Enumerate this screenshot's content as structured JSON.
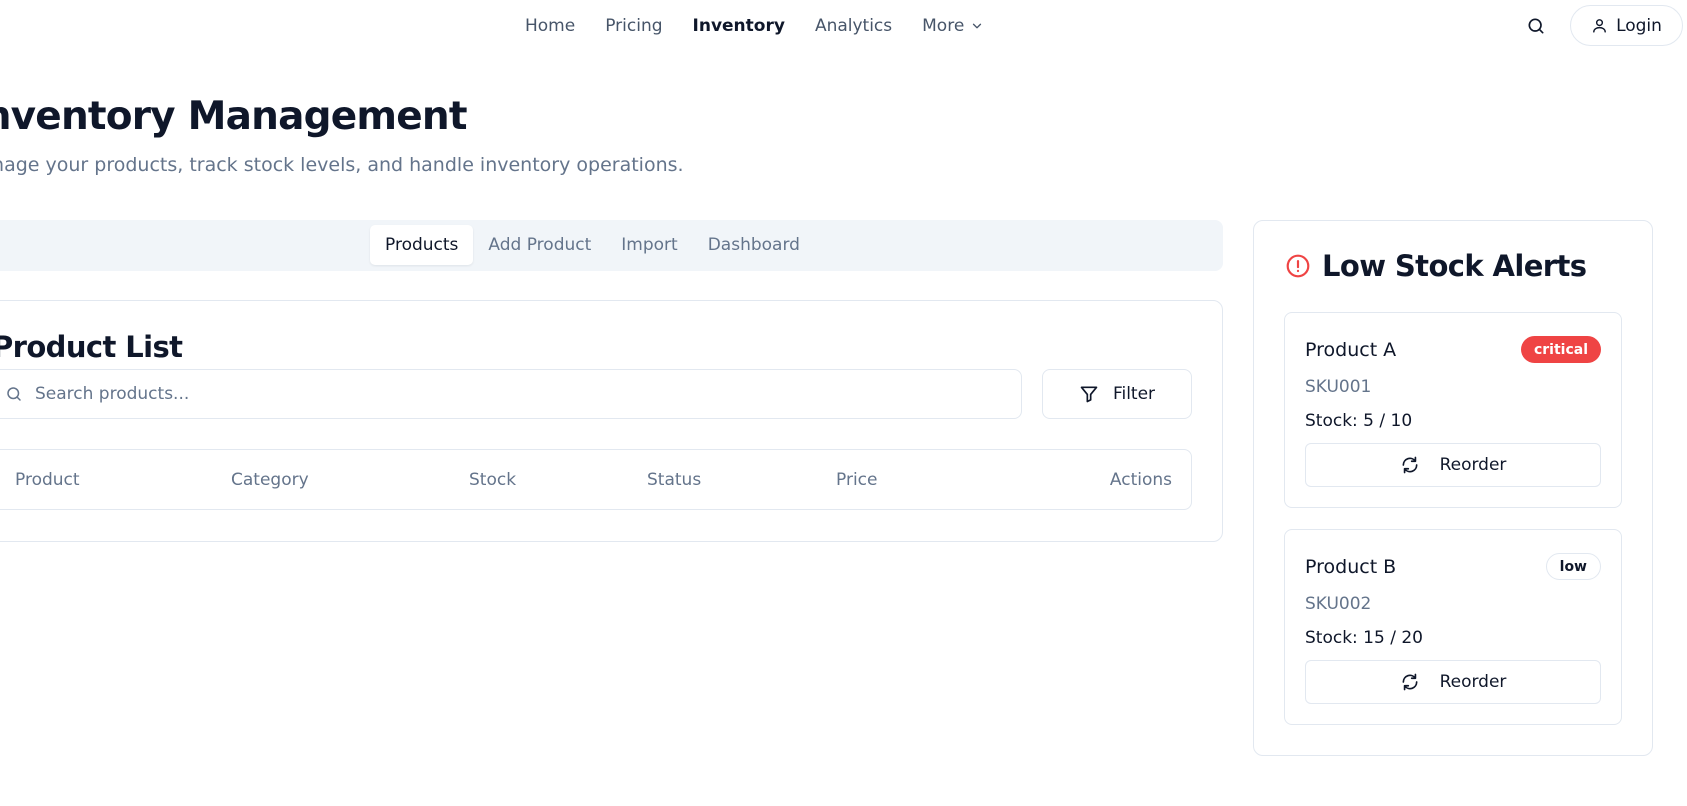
{
  "nav": {
    "links": [
      "Home",
      "Pricing",
      "Inventory",
      "Analytics"
    ],
    "active": "Inventory",
    "more_label": "More",
    "login_label": "Login",
    "icons": {
      "search": "search-icon",
      "user": "user-icon",
      "more": "chevron-down-icon"
    }
  },
  "header": {
    "title": "Inventory Management",
    "subtitle": "Manage your products, track stock levels, and handle inventory operations."
  },
  "tabs": [
    {
      "label": "Products",
      "active": true
    },
    {
      "label": "Add Product",
      "active": false
    },
    {
      "label": "Import",
      "active": false
    },
    {
      "label": "Dashboard",
      "active": false
    }
  ],
  "product_list": {
    "title": "Product List",
    "search_placeholder": "Search products...",
    "search_value": "",
    "filter_label": "Filter",
    "columns": [
      "Product",
      "Category",
      "Stock",
      "Status",
      "Price",
      "Actions"
    ],
    "rows": []
  },
  "alerts": {
    "title": "Low Stock Alerts",
    "icon": "alert-circle-icon",
    "items": [
      {
        "name": "Product A",
        "sku": "SKU001",
        "stock_text": "Stock: 5 / 10",
        "level": "critical",
        "action": "Reorder"
      },
      {
        "name": "Product B",
        "sku": "SKU002",
        "stock_text": "Stock: 15 / 20",
        "level": "low",
        "action": "Reorder"
      }
    ]
  },
  "colors": {
    "text": "#0f172a",
    "muted": "#64748b",
    "border": "#e2e8f0",
    "tabs_bg": "#f1f5f9",
    "critical": "#ef4444"
  }
}
